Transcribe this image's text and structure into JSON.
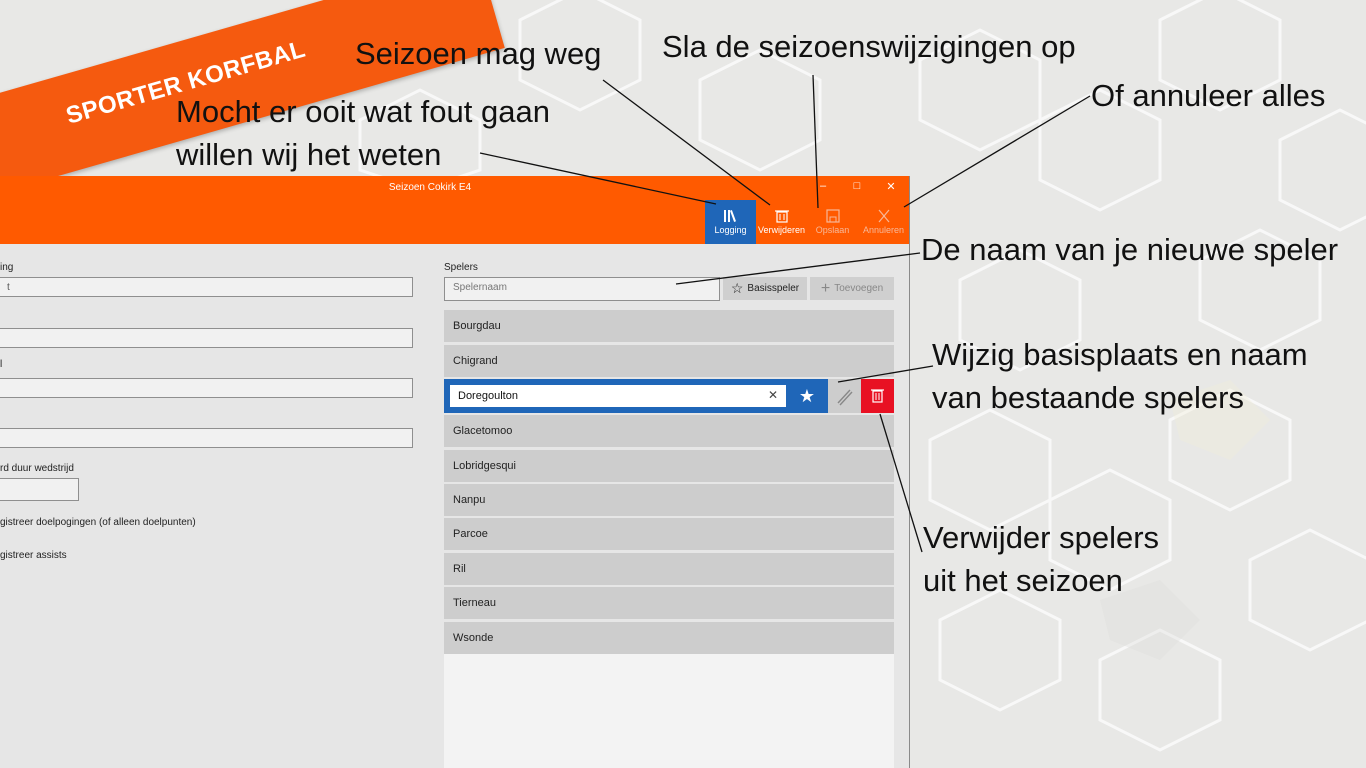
{
  "banner": {
    "text": "SPORTER KORFBAL"
  },
  "annotations": {
    "error": [
      "Mocht er ooit wat fout gaan",
      "willen wij het weten"
    ],
    "delete_season": "Seizoen mag weg",
    "save": "Sla de seizoenswijzigingen op",
    "cancel": "Of annuleer alles",
    "new_player": "De naam van je nieuwe speler",
    "edit_player": [
      "Wijzig basisplaats en naam",
      "van bestaande spelers"
    ],
    "remove_player": [
      "Verwijder spelers",
      "uit het seizoen"
    ]
  },
  "window": {
    "title": "Seizoen Cokirk E4",
    "controls": {
      "minimize": "–",
      "maximize": "□",
      "close": "✕"
    },
    "colors": {
      "accent": "#ff5a00",
      "active": "#1f66b8",
      "danger": "#e81123"
    }
  },
  "commands": {
    "logging": {
      "label": "Logging",
      "icon": "library-icon"
    },
    "delete": {
      "label": "Verwijderen",
      "icon": "trash-icon"
    },
    "save": {
      "label": "Opslaan",
      "icon": "save-icon"
    },
    "cancel": {
      "label": "Annuleren",
      "icon": "close-icon"
    }
  },
  "form": {
    "label1": "ing",
    "value1": "t",
    "label3": "l",
    "duration_label": "rd duur wedstrijd",
    "option_goals": "gistreer doelpogingen (of alleen doelpunten)",
    "option_assists": "gistreer assists"
  },
  "players": {
    "label": "Spelers",
    "placeholder": "Spelernaam",
    "basis_button": "Basisspeler",
    "add_button": "Toevoegen",
    "list": [
      "Bourgdau",
      "Chigrand",
      "Glacetomoo",
      "Lobridgesqui",
      "Nanpu",
      "Parcoe",
      "Ril",
      "Tierneau",
      "Wsonde"
    ],
    "editing": {
      "value": "Doregoulton",
      "clear": "✕",
      "star": "★"
    }
  }
}
